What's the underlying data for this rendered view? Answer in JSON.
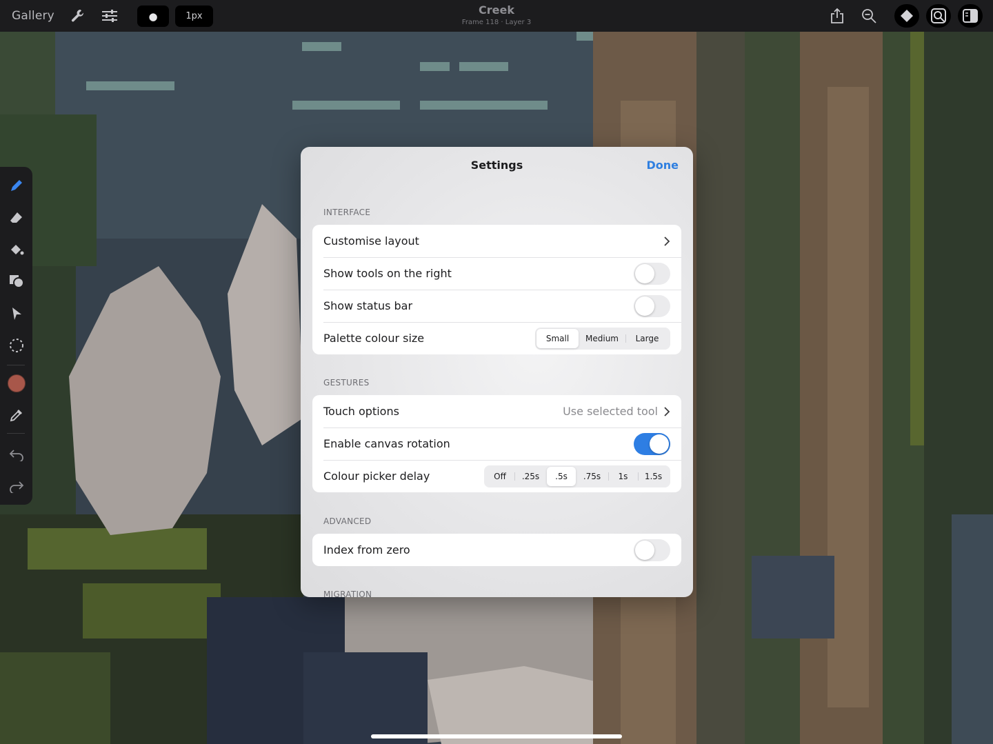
{
  "topbar": {
    "gallery_label": "Gallery",
    "brush_indicator": "●",
    "size_label": "1px",
    "document_title": "Creek",
    "document_subtitle": "Frame 118 · Layer 3",
    "icons": [
      "wrench-icon",
      "sliders-icon",
      "share-icon",
      "zoom-icon",
      "layers-icon",
      "reference-icon",
      "panel-icon"
    ]
  },
  "toolbar": {
    "tools": [
      "pencil-icon",
      "eraser-icon",
      "fill-bucket-icon",
      "shapes-icon",
      "move-arrow-icon",
      "selection-icon",
      "colour-swatch",
      "eyedropper-icon",
      "undo-icon",
      "redo-icon"
    ],
    "current_colour": "#a8574a",
    "accent": "#3a86f0"
  },
  "settings": {
    "title": "Settings",
    "done_label": "Done",
    "sections": {
      "interface": {
        "label": "INTERFACE",
        "customise_layout": "Customise layout",
        "show_tools_right": {
          "label": "Show tools on the right",
          "on": false
        },
        "show_status_bar": {
          "label": "Show status bar",
          "on": false
        },
        "palette_colour_size": {
          "label": "Palette colour size",
          "options": [
            "Small",
            "Medium",
            "Large"
          ],
          "selected": "Small"
        }
      },
      "gestures": {
        "label": "GESTURES",
        "touch_options": {
          "label": "Touch options",
          "value": "Use selected tool"
        },
        "enable_canvas_rotation": {
          "label": "Enable canvas rotation",
          "on": true
        },
        "colour_picker_delay": {
          "label": "Colour picker delay",
          "options": [
            "Off",
            ".25s",
            ".5s",
            ".75s",
            "1s",
            "1.5s"
          ],
          "selected": ".5s"
        }
      },
      "advanced": {
        "label": "ADVANCED",
        "index_from_zero": {
          "label": "Index from zero",
          "on": false
        }
      },
      "migration": {
        "label": "MIGRATION"
      }
    }
  },
  "colors": {
    "toggle_on": "#2e7ee3",
    "link_blue": "#2f7fe0"
  }
}
